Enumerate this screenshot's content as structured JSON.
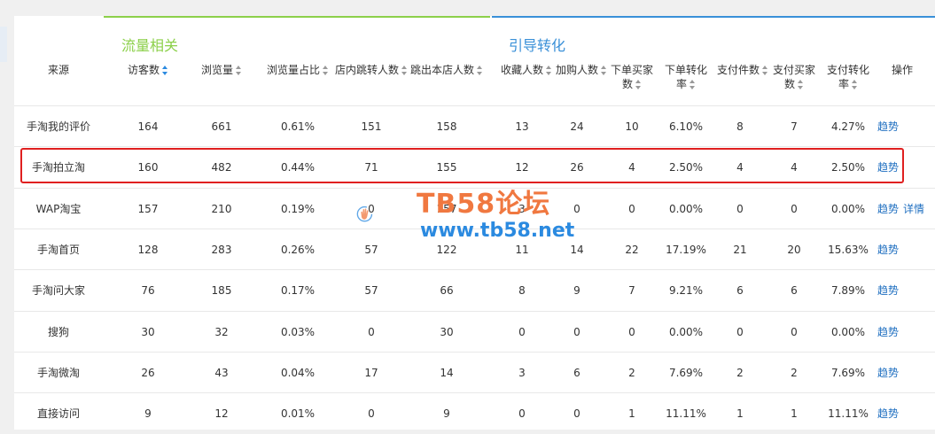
{
  "groups": {
    "traffic": {
      "title": "流量相关",
      "color": "#8cd04a"
    },
    "conversion": {
      "title": "引导转化",
      "color": "#3a90d8"
    }
  },
  "header": {
    "source": "来源",
    "visitors": "访客数",
    "pageviews": "浏览量",
    "pv_ratio": "浏览量占比",
    "in_store_jump": "店内跳转人数",
    "bounce_out": "跳出本店人数",
    "favorites": "收藏人数",
    "add_cart": "加购人数",
    "order_buyers_l1": "下单买家",
    "order_buyers_l2": "数",
    "order_conv_l1": "下单转化",
    "order_conv_l2": "率",
    "pay_items": "支付件数",
    "pay_buyers_l1": "支付买家",
    "pay_buyers_l2": "数",
    "pay_conv_l1": "支付转化",
    "pay_conv_l2": "率",
    "action": "操作"
  },
  "rows": [
    {
      "source": "手淘我的评价",
      "visitors": "164",
      "pv": "661",
      "ratio": "0.61%",
      "jump": "151",
      "bounce": "158",
      "fav": "13",
      "cart": "24",
      "ob": "10",
      "oc": "6.10%",
      "pi": "8",
      "pb": "7",
      "pc": "4.27%",
      "trend": "趋势",
      "detail": ""
    },
    {
      "source": "手淘拍立淘",
      "visitors": "160",
      "pv": "482",
      "ratio": "0.44%",
      "jump": "71",
      "bounce": "155",
      "fav": "12",
      "cart": "26",
      "ob": "4",
      "oc": "2.50%",
      "pi": "4",
      "pb": "4",
      "pc": "2.50%",
      "trend": "趋势",
      "detail": ""
    },
    {
      "source": "WAP淘宝",
      "visitors": "157",
      "pv": "210",
      "ratio": "0.19%",
      "jump": "0",
      "bounce": "157",
      "fav": "3",
      "cart": "0",
      "ob": "0",
      "oc": "0.00%",
      "pi": "0",
      "pb": "0",
      "pc": "0.00%",
      "trend": "趋势",
      "detail": "详情"
    },
    {
      "source": "手淘首页",
      "visitors": "128",
      "pv": "283",
      "ratio": "0.26%",
      "jump": "57",
      "bounce": "122",
      "fav": "11",
      "cart": "14",
      "ob": "22",
      "oc": "17.19%",
      "pi": "21",
      "pb": "20",
      "pc": "15.63%",
      "trend": "趋势",
      "detail": ""
    },
    {
      "source": "手淘问大家",
      "visitors": "76",
      "pv": "185",
      "ratio": "0.17%",
      "jump": "57",
      "bounce": "66",
      "fav": "8",
      "cart": "9",
      "ob": "7",
      "oc": "9.21%",
      "pi": "6",
      "pb": "6",
      "pc": "7.89%",
      "trend": "趋势",
      "detail": ""
    },
    {
      "source": "搜狗",
      "visitors": "30",
      "pv": "32",
      "ratio": "0.03%",
      "jump": "0",
      "bounce": "30",
      "fav": "0",
      "cart": "0",
      "ob": "0",
      "oc": "0.00%",
      "pi": "0",
      "pb": "0",
      "pc": "0.00%",
      "trend": "趋势",
      "detail": ""
    },
    {
      "source": "手淘微淘",
      "visitors": "26",
      "pv": "43",
      "ratio": "0.04%",
      "jump": "17",
      "bounce": "14",
      "fav": "3",
      "cart": "6",
      "ob": "2",
      "oc": "7.69%",
      "pi": "2",
      "pb": "2",
      "pc": "7.69%",
      "trend": "趋势",
      "detail": ""
    },
    {
      "source": "直接访问",
      "visitors": "9",
      "pv": "12",
      "ratio": "0.01%",
      "jump": "0",
      "bounce": "9",
      "fav": "0",
      "cart": "0",
      "ob": "1",
      "oc": "11.11%",
      "pi": "1",
      "pb": "1",
      "pc": "11.11%",
      "trend": "趋势",
      "detail": ""
    }
  ],
  "watermark": {
    "line1": "TB58论坛",
    "line2": "www.tb58.net"
  }
}
